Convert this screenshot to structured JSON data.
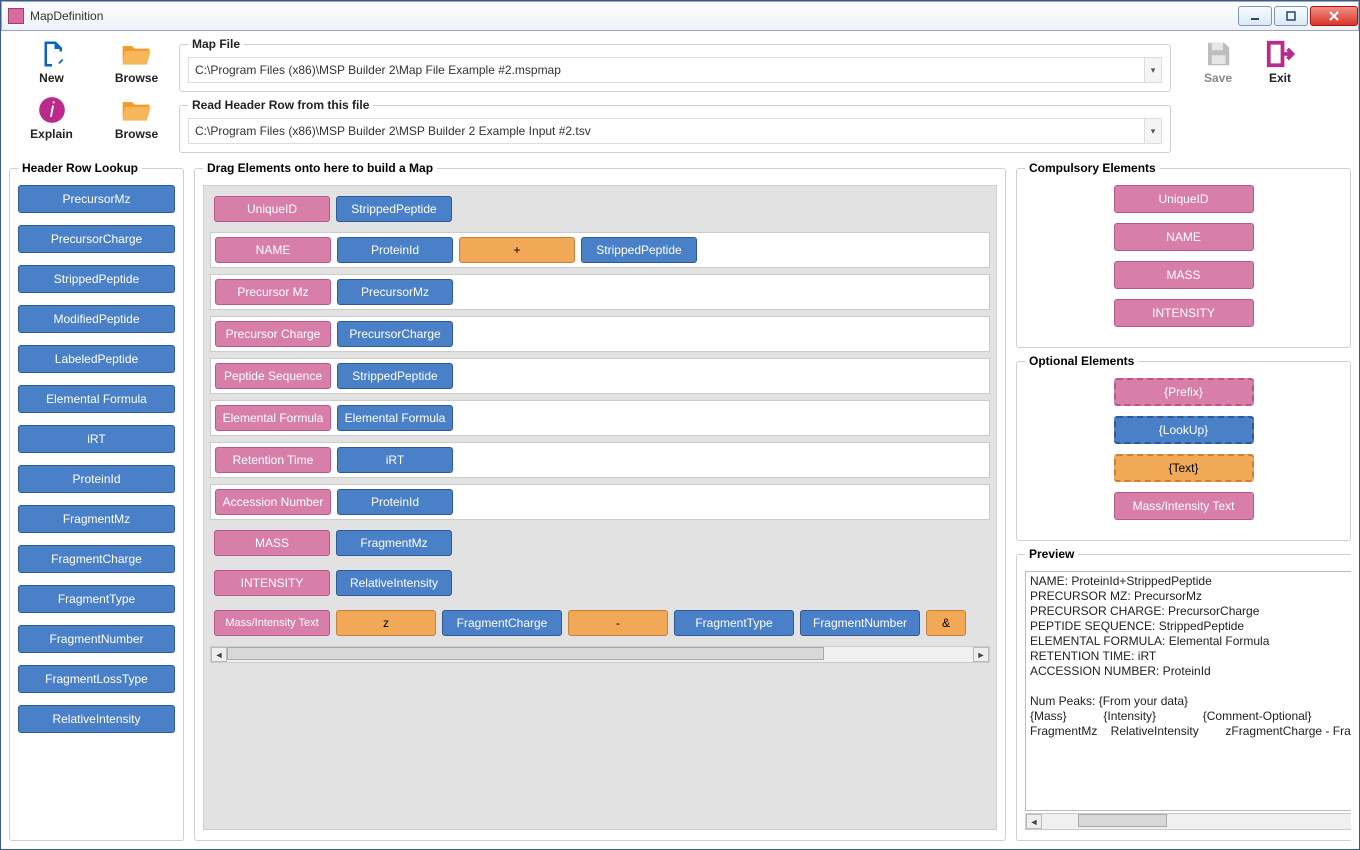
{
  "titlebar": {
    "title": "MapDefinition"
  },
  "toolbar": {
    "new": "New",
    "browse1": "Browse",
    "explain": "Explain",
    "browse2": "Browse",
    "save": "Save",
    "exit": "Exit",
    "mapfile_legend": "Map File",
    "mapfile_value": "C:\\Program Files (x86)\\MSP Builder 2\\Map File Example #2.mspmap",
    "header_legend": "Read Header Row from this file",
    "header_value": "C:\\Program Files (x86)\\MSP Builder 2\\MSP Builder 2 Example Input #2.tsv"
  },
  "left": {
    "legend": "Header Row Lookup",
    "items": [
      "PrecursorMz",
      "PrecursorCharge",
      "StrippedPeptide",
      "ModifiedPeptide",
      "LabeledPeptide",
      "Elemental Formula",
      "iRT",
      "ProteinId",
      "FragmentMz",
      "FragmentCharge",
      "FragmentType",
      "FragmentNumber",
      "FragmentLossType",
      "RelativeIntensity"
    ]
  },
  "mid": {
    "legend": "Drag Elements onto here to build a Map",
    "rows": [
      {
        "bg": "trans",
        "cells": [
          {
            "t": "UniqueID",
            "c": "pink"
          },
          {
            "t": "StrippedPeptide",
            "c": "blue"
          }
        ]
      },
      {
        "cells": [
          {
            "t": "NAME",
            "c": "pink"
          },
          {
            "t": "ProteinId",
            "c": "blue"
          },
          {
            "t": "+",
            "c": "orange"
          },
          {
            "t": "StrippedPeptide",
            "c": "blue"
          }
        ]
      },
      {
        "cells": [
          {
            "t": "Precursor Mz",
            "c": "pink"
          },
          {
            "t": "PrecursorMz",
            "c": "blue"
          }
        ]
      },
      {
        "cells": [
          {
            "t": "Precursor Charge",
            "c": "pink"
          },
          {
            "t": "PrecursorCharge",
            "c": "blue"
          }
        ]
      },
      {
        "cells": [
          {
            "t": "Peptide Sequence",
            "c": "pink"
          },
          {
            "t": "StrippedPeptide",
            "c": "blue"
          }
        ]
      },
      {
        "cells": [
          {
            "t": "Elemental Formula",
            "c": "pink"
          },
          {
            "t": "Elemental Formula",
            "c": "blue"
          }
        ]
      },
      {
        "cells": [
          {
            "t": "Retention Time",
            "c": "pink"
          },
          {
            "t": "iRT",
            "c": "blue"
          }
        ]
      },
      {
        "cells": [
          {
            "t": "Accession Number",
            "c": "pink"
          },
          {
            "t": "ProteinId",
            "c": "blue"
          }
        ]
      },
      {
        "bg": "trans",
        "cells": [
          {
            "t": "MASS",
            "c": "pink"
          },
          {
            "t": "FragmentMz",
            "c": "blue"
          }
        ]
      },
      {
        "bg": "trans",
        "cells": [
          {
            "t": "INTENSITY",
            "c": "pink"
          },
          {
            "t": "RelativeIntensity",
            "c": "blue"
          }
        ]
      }
    ],
    "lastrow": {
      "cells": [
        {
          "t": "Mass/Intensity Text",
          "c": "pink"
        },
        {
          "t": "z",
          "c": "orange"
        },
        {
          "t": "FragmentCharge",
          "c": "blue"
        },
        {
          "t": "-",
          "c": "orange"
        },
        {
          "t": "FragmentType",
          "c": "blue"
        },
        {
          "t": "FragmentNumber",
          "c": "blue"
        },
        {
          "t": "&",
          "c": "orange"
        }
      ]
    }
  },
  "right": {
    "comp_legend": "Compulsory Elements",
    "comp": [
      "UniqueID",
      "NAME",
      "MASS",
      "INTENSITY"
    ],
    "opt_legend": "Optional Elements",
    "opt": [
      {
        "t": "{Prefix}",
        "c": "pink",
        "d": true
      },
      {
        "t": "{LookUp}",
        "c": "blue",
        "d": true
      },
      {
        "t": "{Text}",
        "c": "orange",
        "d": true
      },
      {
        "t": "Mass/Intensity Text",
        "c": "pink",
        "d": false
      }
    ],
    "preview_legend": "Preview",
    "preview_text": "NAME: ProteinId+StrippedPeptide\nPRECURSOR MZ: PrecursorMz\nPRECURSOR CHARGE: PrecursorCharge\nPEPTIDE SEQUENCE: StrippedPeptide\nELEMENTAL FORMULA: Elemental Formula\nRETENTION TIME: iRT\nACCESSION NUMBER: ProteinId\n\nNum Peaks: {From your data}\n{Mass}           {Intensity}              {Comment-Optional}\nFragmentMz    RelativeIntensity        zFragmentCharge - FragmentType"
  }
}
